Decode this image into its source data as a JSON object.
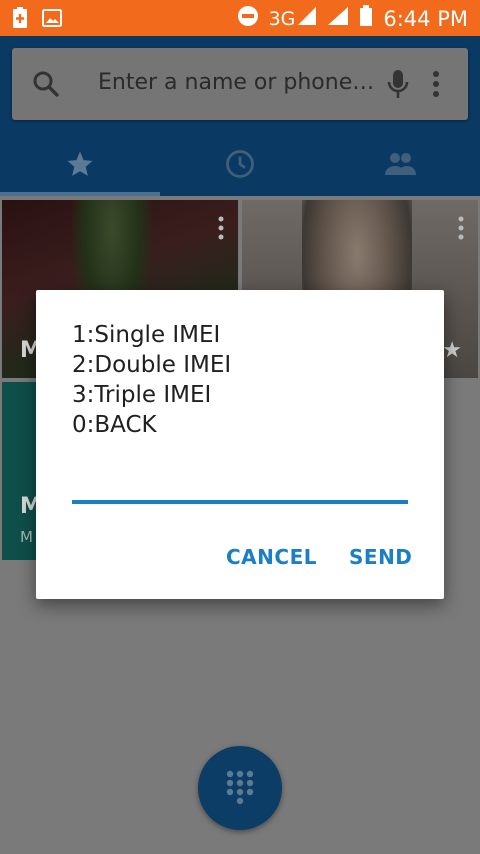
{
  "status_bar": {
    "network": "3G",
    "time": "6:44 PM"
  },
  "search": {
    "placeholder": "Enter a name or phone…"
  },
  "tabs": [
    {
      "icon": "star-icon"
    },
    {
      "icon": "clock-icon"
    },
    {
      "icon": "people-icon"
    }
  ],
  "favorites": [
    {
      "letter": "M",
      "sub": ""
    },
    {
      "letter": "",
      "sub": ""
    },
    {
      "letter": "M",
      "sub": "M"
    }
  ],
  "dialog": {
    "lines": [
      "1:Single IMEI",
      "2:Double IMEI",
      "3:Triple IMEI",
      "0:BACK"
    ],
    "input_value": "",
    "cancel_label": "CANCEL",
    "send_label": "SEND"
  },
  "colors": {
    "status_bar": "#f26a1b",
    "accent": "#1a7fc4"
  }
}
